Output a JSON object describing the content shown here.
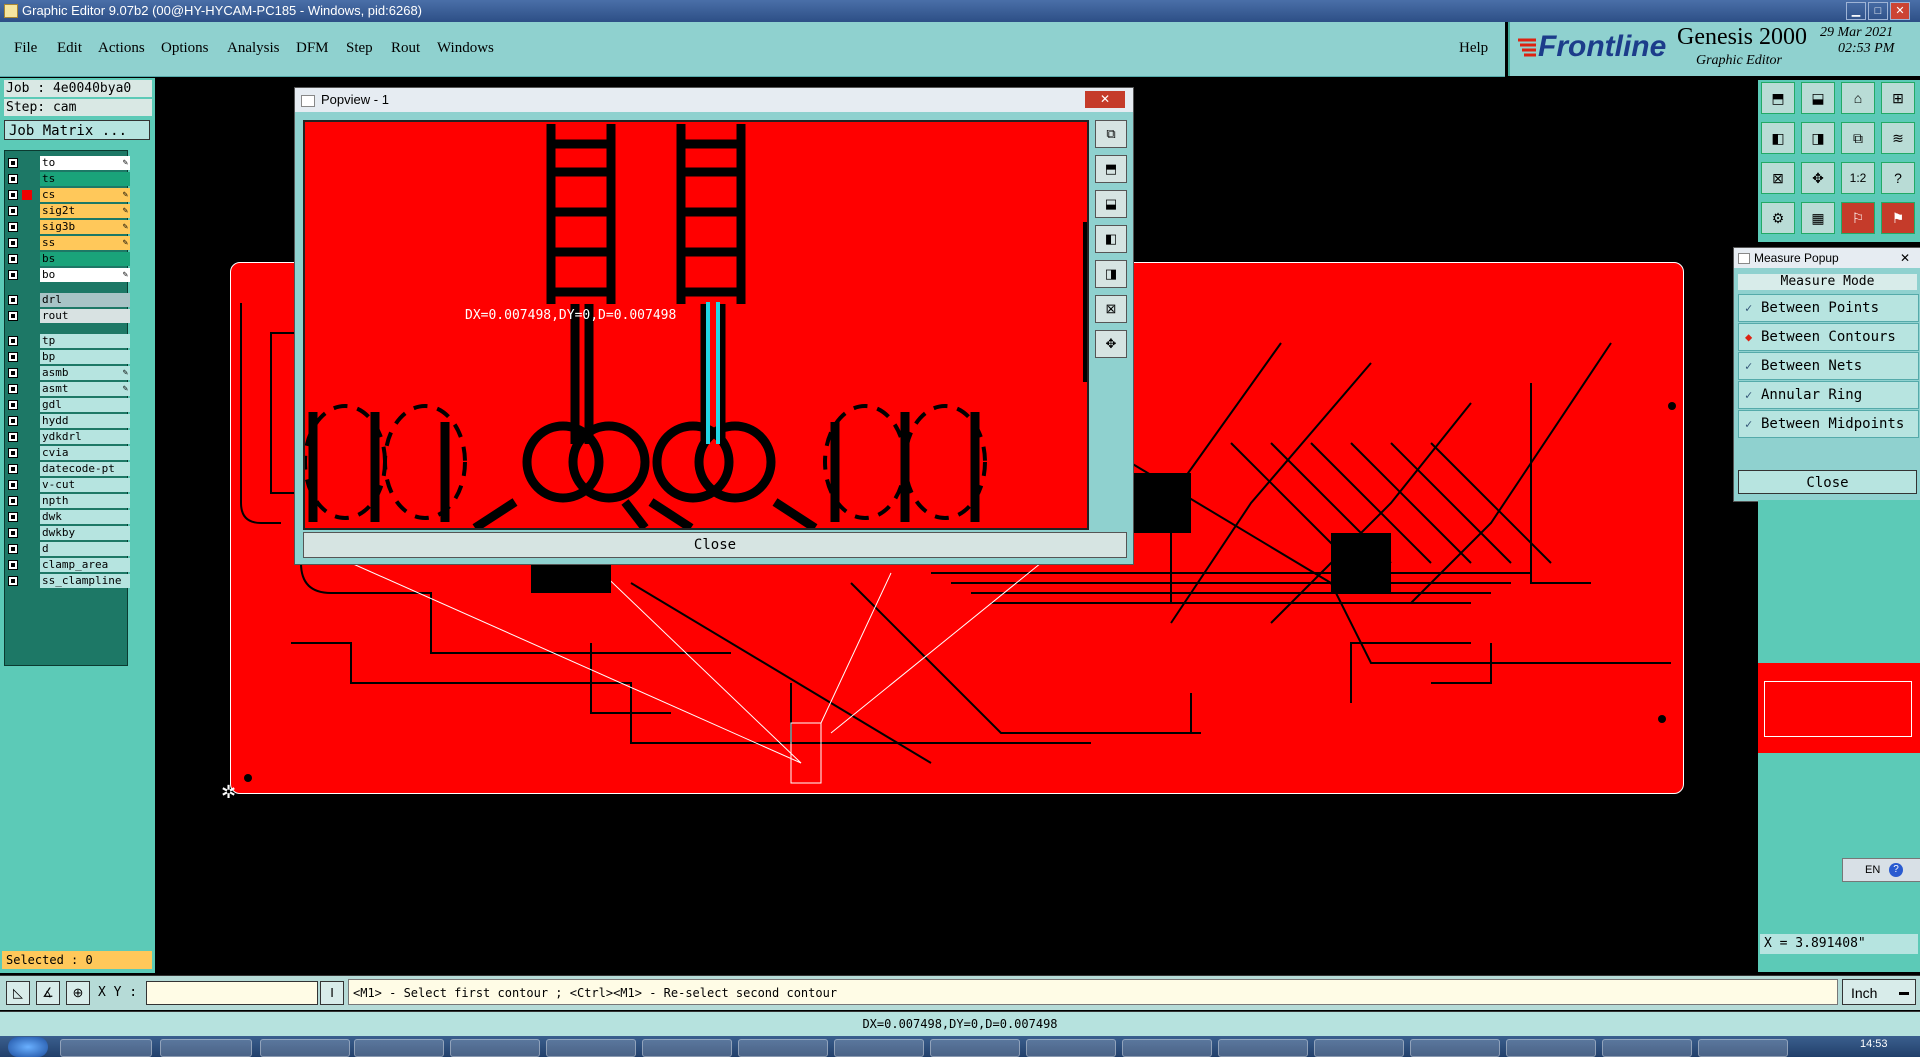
{
  "window": {
    "title": "Graphic Editor 9.07b2 (00@HY-HYCAM-PC185 - Windows, pid:6268)"
  },
  "menu": {
    "items": [
      "File",
      "Edit",
      "Actions",
      "Options",
      "Analysis",
      "DFM",
      "Step",
      "Rout",
      "Windows"
    ],
    "help": "Help"
  },
  "brand": {
    "logo": "Frontline",
    "product": "Genesis 2000",
    "subtitle": "Graphic Editor",
    "date": "29 Mar 2021",
    "time": "02:53 PM"
  },
  "job": {
    "job_label": "Job : 4e0040bya0",
    "step_label": "Step: cam",
    "matrix_button": "Job Matrix ..."
  },
  "layers": [
    {
      "name": "to",
      "color": "#ffffff",
      "editable": true
    },
    {
      "name": "ts",
      "color": "#1aa37a",
      "editable": false
    },
    {
      "name": "cs",
      "color": "#ffc85a",
      "editable": true,
      "active": true
    },
    {
      "name": "sig2t",
      "color": "#ffc85a",
      "editable": true
    },
    {
      "name": "sig3b",
      "color": "#ffc85a",
      "editable": true
    },
    {
      "name": "ss",
      "color": "#ffc85a",
      "editable": true
    },
    {
      "name": "bs",
      "color": "#1aa37a",
      "editable": false
    },
    {
      "name": "bo",
      "color": "#ffffff",
      "editable": true
    },
    {
      "name": "drl",
      "color": "#a8c4c6",
      "editable": false
    },
    {
      "name": "rout",
      "color": "#d8e2e2",
      "editable": false
    },
    {
      "name": "tp",
      "color": "#b6e4e0",
      "editable": false
    },
    {
      "name": "bp",
      "color": "#b6e4e0",
      "editable": false
    },
    {
      "name": "asmb",
      "color": "#b6e4e0",
      "editable": true
    },
    {
      "name": "asmt",
      "color": "#b6e4e0",
      "editable": true
    },
    {
      "name": "gdl",
      "color": "#b6e4e0",
      "editable": false
    },
    {
      "name": "hydd",
      "color": "#b6e4e0",
      "editable": false
    },
    {
      "name": "ydkdrl",
      "color": "#b6e4e0",
      "editable": false
    },
    {
      "name": "cvia",
      "color": "#b6e4e0",
      "editable": false
    },
    {
      "name": "datecode-pt",
      "color": "#b6e4e0",
      "editable": false
    },
    {
      "name": "v-cut",
      "color": "#b6e4e0",
      "editable": false
    },
    {
      "name": "npth",
      "color": "#b6e4e0",
      "editable": false
    },
    {
      "name": "dwk",
      "color": "#b6e4e0",
      "editable": false
    },
    {
      "name": "dwkby",
      "color": "#b6e4e0",
      "editable": false
    },
    {
      "name": "d",
      "color": "#b6e4e0",
      "editable": false
    },
    {
      "name": "clamp_area",
      "color": "#b6e4e0",
      "editable": false
    },
    {
      "name": "ss_clampline",
      "color": "#b6e4e0",
      "editable": false
    }
  ],
  "selected": "Selected : 0",
  "popview": {
    "title": "Popview - 1",
    "measure_text": "DX=0.007498,DY=0,D=0.007498",
    "close": "Close"
  },
  "measure_popup": {
    "title": "Measure Popup",
    "header": "Measure Mode",
    "options": [
      {
        "label": "Between Points",
        "selected": false
      },
      {
        "label": "Between Contours",
        "selected": true
      },
      {
        "label": "Between Nets",
        "selected": false
      },
      {
        "label": "Annular Ring",
        "selected": false
      },
      {
        "label": "Between Midpoints",
        "selected": false
      }
    ],
    "close": "Close"
  },
  "right_toolbar": {
    "zoom_label": "1:2",
    "help_label": "?"
  },
  "coord_readout": "X = 3.891408\"",
  "lang": "EN",
  "command": {
    "xy_label": "X Y :",
    "xy_value": "",
    "prompt": "<M1> - Select first contour ; <Ctrl><M1> - Re-select second contour",
    "units": "Inch"
  },
  "status_line": "DX=0.007498,DY=0,D=0.007498",
  "clock": "14:53",
  "colors": {
    "board": "#ff0000",
    "panel": "#5ccab7",
    "menu": "#8fd1cf",
    "selected_bar": "#ffc85a"
  }
}
